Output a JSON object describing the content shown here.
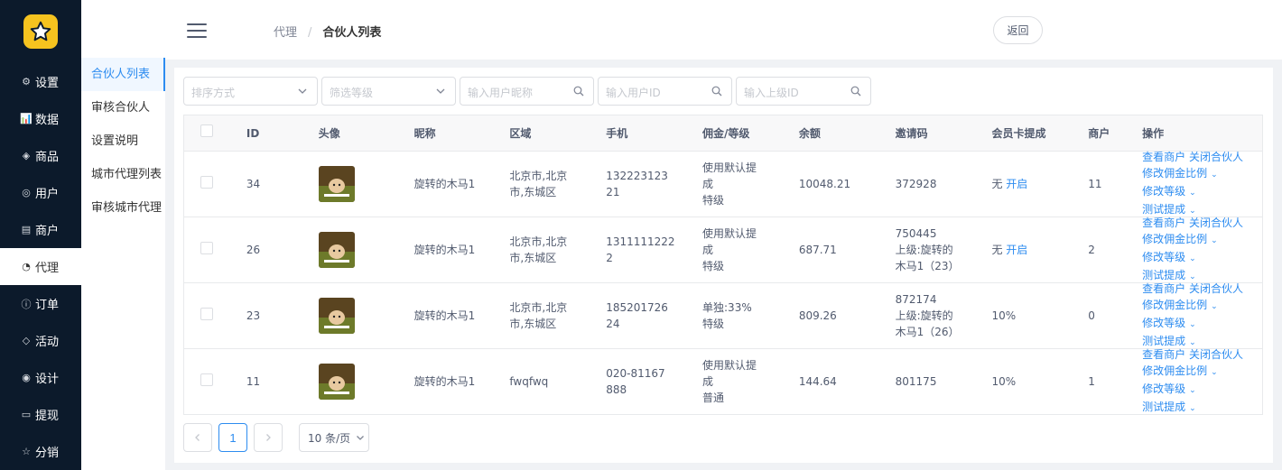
{
  "nav": {
    "items": [
      {
        "label": "设置",
        "icon": "gear-icon"
      },
      {
        "label": "数据",
        "icon": "chart-icon"
      },
      {
        "label": "商品",
        "icon": "box-icon"
      },
      {
        "label": "用户",
        "icon": "user-icon"
      },
      {
        "label": "商户",
        "icon": "store-icon"
      },
      {
        "label": "代理",
        "icon": "agent-icon",
        "active": true
      },
      {
        "label": "订单",
        "icon": "info-icon"
      },
      {
        "label": "活动",
        "icon": "tag-icon"
      },
      {
        "label": "设计",
        "icon": "design-icon"
      },
      {
        "label": "提现",
        "icon": "card-icon"
      },
      {
        "label": "分销",
        "icon": "star-icon"
      }
    ]
  },
  "subnav": {
    "items": [
      "合伙人列表",
      "审核合伙人",
      "设置说明",
      "城市代理列表",
      "审核城市代理"
    ]
  },
  "header": {
    "breadcrumb_parent": "代理",
    "breadcrumb_sep": "/",
    "breadcrumb_current": "合伙人列表",
    "back_label": "返回"
  },
  "filters": {
    "sort_placeholder": "排序方式",
    "level_placeholder": "筛选等级",
    "nickname_placeholder": "输入用户昵称",
    "userid_placeholder": "输入用户ID",
    "parentid_placeholder": "输入上级ID"
  },
  "table": {
    "columns": [
      "ID",
      "头像",
      "昵称",
      "区域",
      "手机",
      "佣金/等级",
      "余额",
      "邀请码",
      "会员卡提成",
      "商户",
      "操作"
    ],
    "rows": [
      {
        "id": "34",
        "nickname": "旋转的木马1",
        "area": "北京市,北京市,东城区",
        "phone": "13222312321",
        "commission": "使用默认提成",
        "level": "特级",
        "balance": "10048.21",
        "invite_code": "372928",
        "parent": "",
        "card_status": "无",
        "card_action": "开启",
        "shops": "11",
        "ops": {
          "view": "查看商户",
          "close": "关闭合伙人",
          "ratio": "修改佣金比例",
          "grade": "修改等级",
          "test": "测试提成"
        }
      },
      {
        "id": "26",
        "nickname": "旋转的木马1",
        "area": "北京市,北京市,东城区",
        "phone": "13111112222",
        "commission": "使用默认提成",
        "level": "特级",
        "balance": "687.71",
        "invite_code": "750445",
        "parent": "上级:旋转的木马1（23）",
        "card_status": "无",
        "card_action": "开启",
        "shops": "2",
        "ops": {
          "view": "查看商户",
          "close": "关闭合伙人",
          "ratio": "修改佣金比例",
          "grade": "修改等级",
          "test": "测试提成"
        }
      },
      {
        "id": "23",
        "nickname": "旋转的木马1",
        "area": "北京市,北京市,东城区",
        "phone": "18520172624",
        "commission": "单独:33%",
        "level": "特级",
        "balance": "809.26",
        "invite_code": "872174",
        "parent": "上级:旋转的木马1（26）",
        "card_status": "10%",
        "card_action": "",
        "shops": "0",
        "ops": {
          "view": "查看商户",
          "close": "关闭合伙人",
          "ratio": "修改佣金比例",
          "grade": "修改等级",
          "test": "测试提成"
        }
      },
      {
        "id": "11",
        "nickname": "旋转的木马1",
        "area": "fwqfwq",
        "phone": "020-81167888",
        "commission": "使用默认提成",
        "level": "普通",
        "balance": "144.64",
        "invite_code": "801175",
        "parent": "",
        "card_status": "10%",
        "card_action": "",
        "shops": "1",
        "ops": {
          "view": "查看商户",
          "close": "关闭合伙人",
          "ratio": "修改佣金比例",
          "grade": "修改等级",
          "test": "测试提成"
        }
      }
    ]
  },
  "pagination": {
    "current_page": "1",
    "page_size_label": "10 条/页"
  },
  "colors": {
    "sidebar_bg": "#0c1a2b",
    "accent": "#2d8cf0",
    "logo": "#f6c31f"
  }
}
